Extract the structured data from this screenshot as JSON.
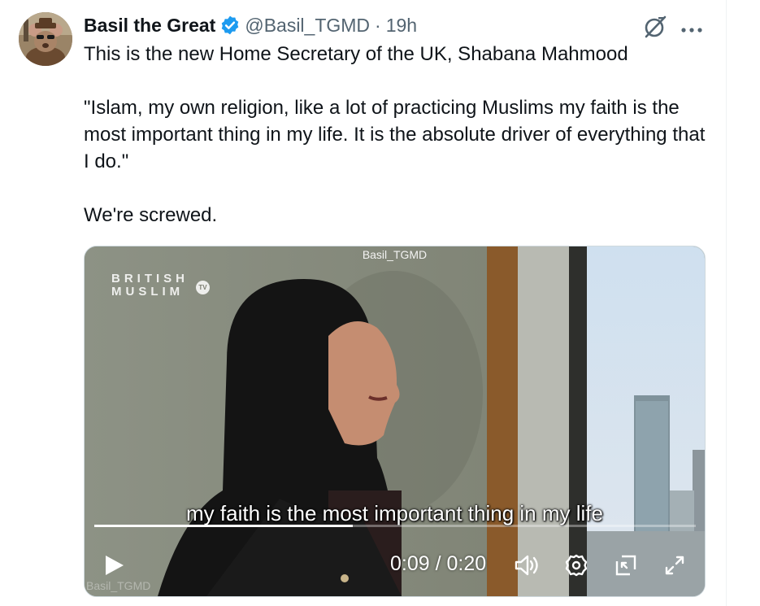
{
  "tweet": {
    "author": {
      "display_name": "Basil the Great",
      "handle": "@Basil_TGMD",
      "verified": true,
      "avatar_icon": "avatar-cartoon-mouse-icon"
    },
    "separator": "·",
    "timestamp": "19h",
    "text": {
      "line1": "This is the new Home Secretary of the UK, Shabana Mahmood",
      "quote": "\"Islam, my own religion, like a lot of practicing Muslims my faith is the most important thing in my life. It is the absolute driver of everything that I do.\"",
      "closing": "We're screwed."
    },
    "actions": {
      "grok_icon": "grok-icon",
      "more_icon": "more-icon"
    }
  },
  "video": {
    "watermark_top": "Basil_TGMD",
    "watermark_bottom": "Basil_TGMD",
    "brand_line1": "BRITISH",
    "brand_line2": "MUSLIM",
    "brand_badge": "TV",
    "subtitle": "my faith is the most important thing in my life",
    "current_time": "0:09",
    "duration": "0:20",
    "time_separator": " / ",
    "progress_fraction": 0.43,
    "controls": [
      "play-icon",
      "volume-icon",
      "settings-icon",
      "pip-icon",
      "fullscreen-icon"
    ]
  },
  "colors": {
    "text_primary": "#0f1419",
    "text_secondary": "#536471",
    "verified_blue": "#1d9bf0",
    "border": "#cfd9de"
  }
}
